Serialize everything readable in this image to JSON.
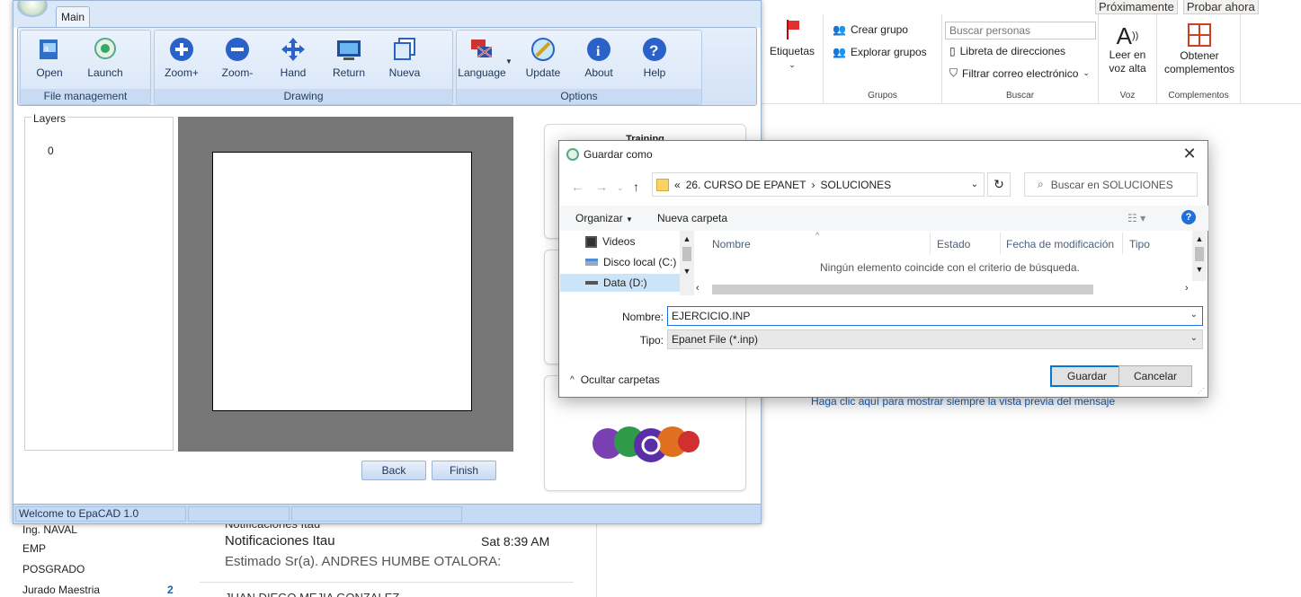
{
  "outlook": {
    "top": {
      "coming_soon": "Próximamente",
      "try_now": "Probar ahora"
    },
    "ribbon": {
      "tags": {
        "label": "Etiquetas"
      },
      "groups": {
        "create": "Crear grupo",
        "explore": "Explorar grupos",
        "label": "Grupos"
      },
      "search": {
        "placeholder": "Buscar personas",
        "address_book": "Libreta de direcciones",
        "filter_mail": "Filtrar correo electrónico",
        "label": "Buscar"
      },
      "voice": {
        "read_aloud": "Leer en voz alta",
        "label": "Voz"
      },
      "addins": {
        "get": "Obtener complementos",
        "label": "Complementos"
      }
    },
    "preview_link": "Haga clic aquí para mostrar siempre la vista previa del mensaje",
    "folders": [
      {
        "name": "Ing. NAVAL",
        "count": ""
      },
      {
        "name": "EMP",
        "count": ""
      },
      {
        "name": "POSGRADO",
        "count": ""
      },
      {
        "name": "Jurado Maestria",
        "count": "2"
      }
    ],
    "mail": {
      "header_partial": "Notificaciones Itau",
      "sender": "Notificaciones Itau",
      "time": "Sat 8:39 AM",
      "snippet": "Estimado Sr(a). ANDRES HUMBE OTALORA:",
      "next_sender_partial": "JUAN DIEGO MEJIA GONZALEZ"
    }
  },
  "epacad": {
    "tab": "Main",
    "groups": [
      {
        "label": "File management",
        "buttons": [
          "Open",
          "Launch"
        ]
      },
      {
        "label": "Drawing",
        "buttons": [
          "Zoom+",
          "Zoom-",
          "Hand",
          "Return",
          "Nueva"
        ]
      },
      {
        "label": "Options",
        "buttons": [
          "Language",
          "Update",
          "About",
          "Help"
        ]
      }
    ],
    "layers": {
      "title": "Layers",
      "items": [
        "0"
      ]
    },
    "wizard": {
      "back": "Back",
      "finish": "Finish"
    },
    "side_panel_title": "Training",
    "status": "Welcome to EpaCAD 1.0"
  },
  "dialog": {
    "title": "Guardar como",
    "address": {
      "prefix": "«",
      "path": [
        "26. CURSO DE EPANET",
        "SOLUCIONES"
      ]
    },
    "search_placeholder": "Buscar en SOLUCIONES",
    "toolbar": {
      "organize": "Organizar",
      "new_folder": "Nueva carpeta"
    },
    "nav": [
      "Videos",
      "Disco local (C:)",
      "Data (D:)"
    ],
    "columns": [
      "Nombre",
      "Estado",
      "Fecha de modificación",
      "Tipo"
    ],
    "empty_message": "Ningún elemento coincide con el criterio de búsqueda.",
    "name_label": "Nombre:",
    "name_value": "EJERCICIO.INP",
    "type_label": "Tipo:",
    "type_value": "Epanet File (*.inp)",
    "hide_folders": "Ocultar carpetas",
    "save": "Guardar",
    "cancel": "Cancelar"
  }
}
